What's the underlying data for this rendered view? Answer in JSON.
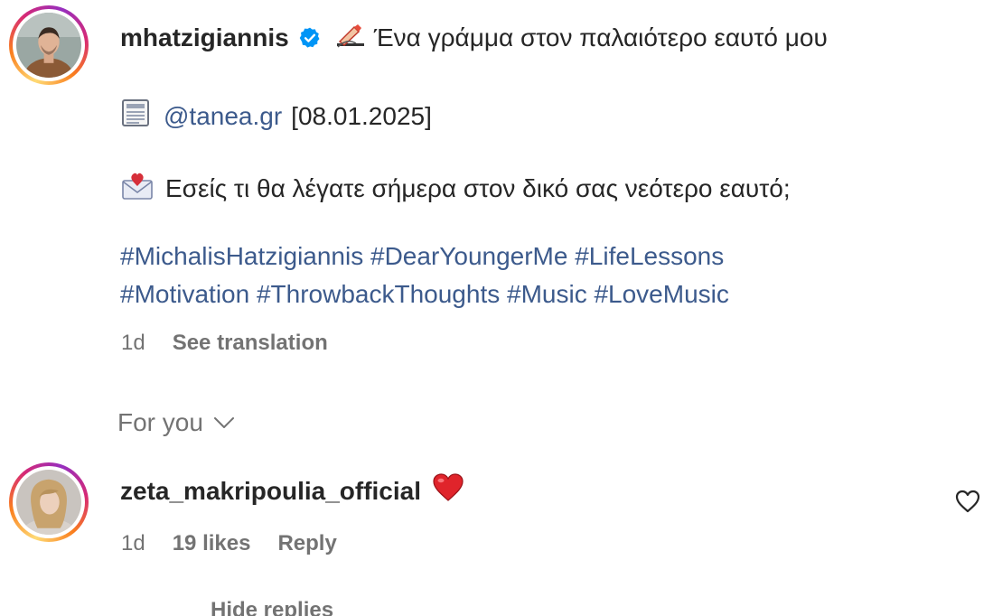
{
  "post": {
    "username": "mhatzigiannis",
    "verified": true,
    "caption_emoji": "writing-hand-icon",
    "caption_title": "Ένα γράμμα στον παλαιότερο εαυτό μου",
    "source_emoji": "newspaper-icon",
    "source_mention": "@tanea.gr",
    "source_date": "[08.01.2025]",
    "question_emoji": "envelope-heart-icon",
    "question_text": "Εσείς τι θα λέγατε σήμερα στον δικό σας νεότερο εαυτό;",
    "hashtags_line1": "#MichalisHatzigiannis #DearYoungerMe #LifeLessons",
    "hashtags_line2": "#Motivation #ThrowbackThoughts #Music #LoveMusic",
    "time_ago": "1d",
    "see_translation": "See translation"
  },
  "filter": {
    "label": "For you"
  },
  "comment": {
    "username": "zeta_makripoulia_official",
    "content_emoji": "red-heart-icon",
    "time_ago": "1d",
    "likes": "19 likes",
    "reply_label": "Reply",
    "hide_replies": "Hide replies"
  },
  "colors": {
    "link": "#3c5a8c",
    "muted": "#737373",
    "text": "#262626",
    "verified": "#0095f6"
  }
}
